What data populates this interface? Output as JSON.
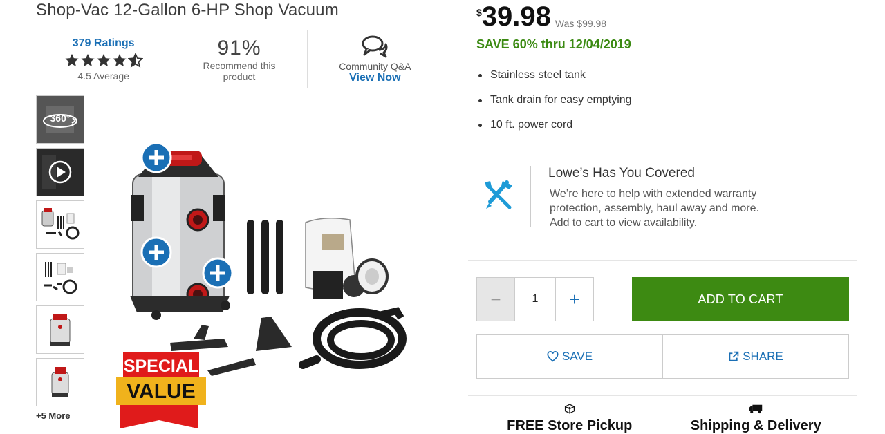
{
  "product": {
    "title": "Shop-Vac 12-Gallon 6-HP Shop Vacuum"
  },
  "stats": {
    "ratings_link": "379 Ratings",
    "rating_value": 4.5,
    "average_text": "4.5 Average",
    "recommend_pct": "91%",
    "recommend_text": "Recommend this product",
    "qa_label": "Community Q&A",
    "qa_link": "View Now"
  },
  "gallery": {
    "more_label": "+5 More",
    "spin_label": "360°",
    "badge_top": "SPECIAL",
    "badge_bottom": "VALUE"
  },
  "pricing": {
    "currency": "$",
    "price": "39.98",
    "was": "Was $99.98",
    "save": "SAVE 60% thru 12/04/2019"
  },
  "features": [
    "Stainless steel tank",
    "Tank drain for easy emptying",
    "10 ft. power cord"
  ],
  "covered": {
    "title": "Lowe’s Has You Covered",
    "lines": [
      "We’re here to help with extended warranty",
      "protection, assembly, haul away and more.",
      "Add to cart to view availability."
    ]
  },
  "cart": {
    "minus": "−",
    "quantity": "1",
    "plus": "+",
    "add_label": "ADD TO CART"
  },
  "actions": {
    "save_label": "SAVE",
    "share_label": "SHARE"
  },
  "fulfillment": {
    "pickup_label": "FREE Store Pickup",
    "delivery_label": "Shipping & Delivery"
  },
  "colors": {
    "link_blue": "#1a6fb5",
    "cart_green": "#3d8a12",
    "save_green": "#3b8a12"
  }
}
